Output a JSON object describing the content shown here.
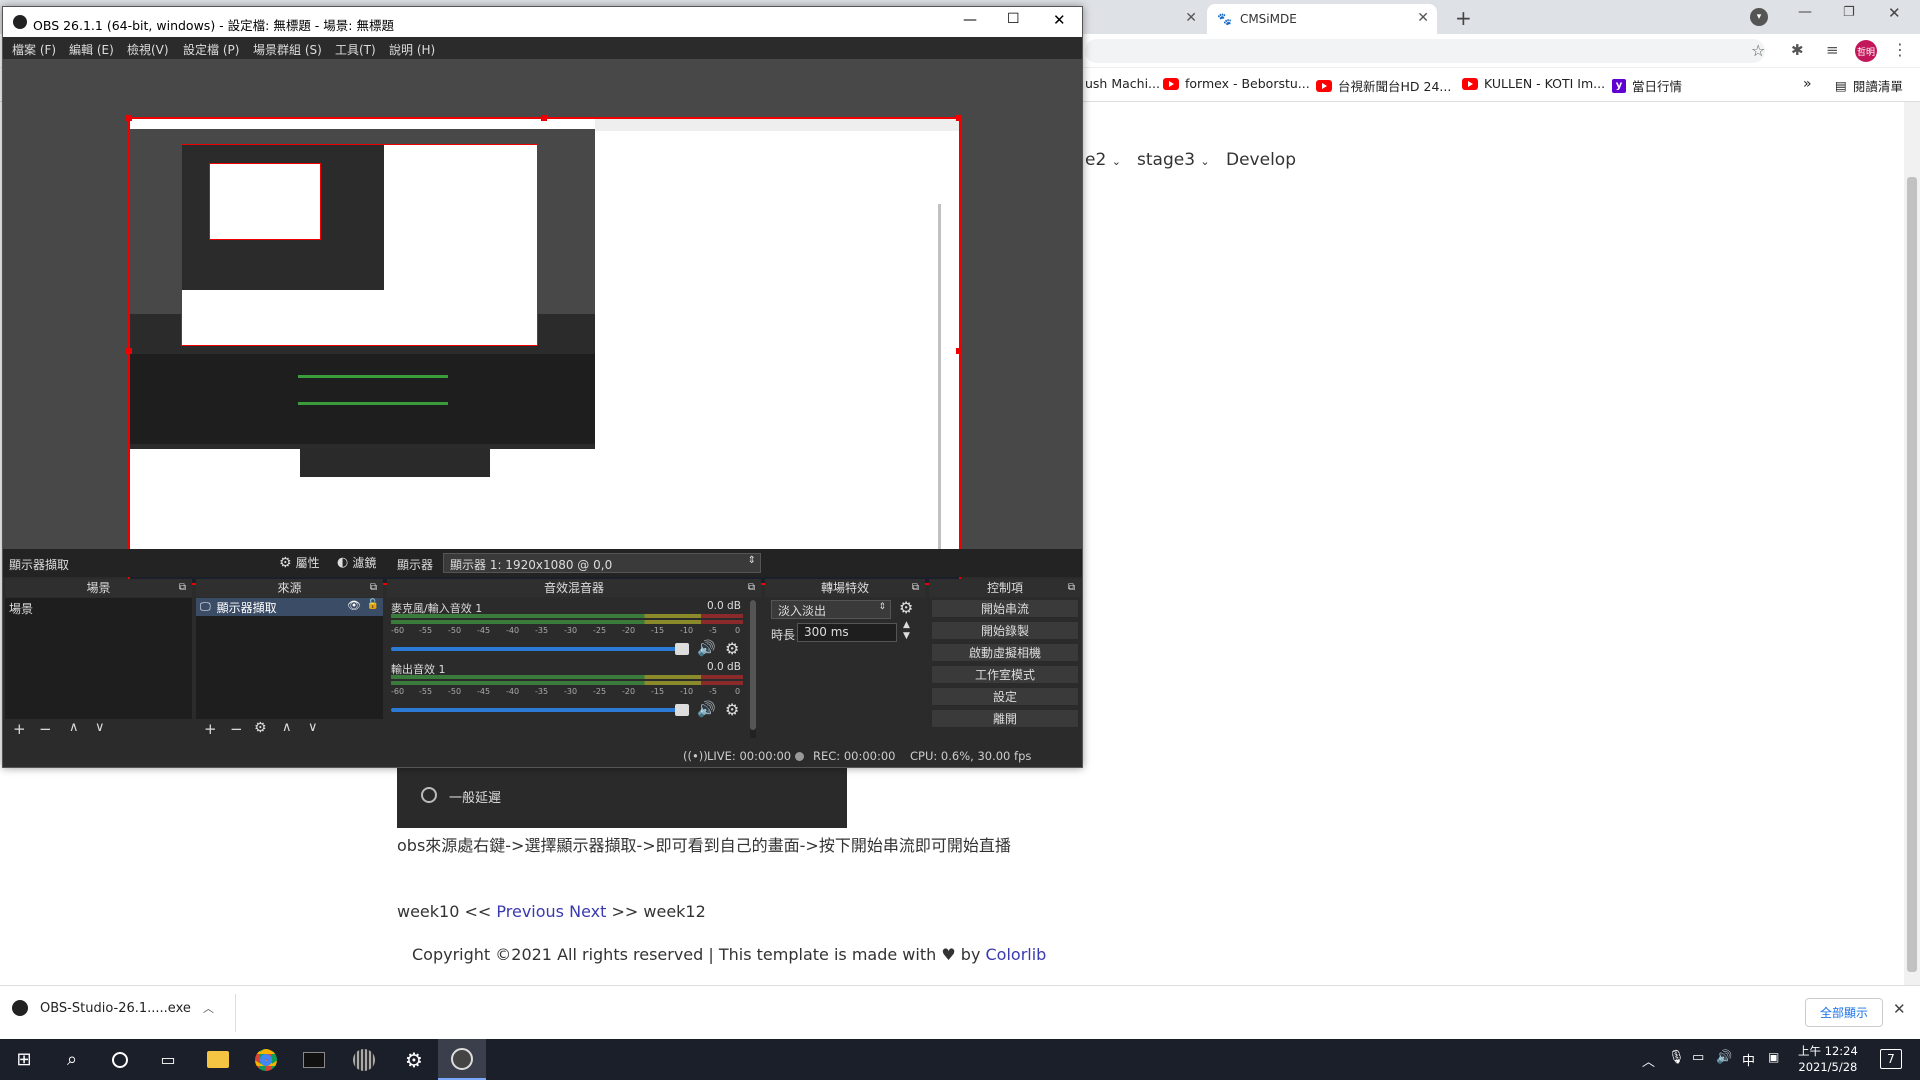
{
  "browser": {
    "tabs": [
      {
        "label": ""
      },
      {
        "label": "CMSiMDE"
      }
    ],
    "new_tab": "+",
    "bookmarks": [
      {
        "label": "ush Machi..."
      },
      {
        "label": "formex - Beborstu..."
      },
      {
        "label": "台視新聞台HD 24..."
      },
      {
        "label": "KULLEN - KOTI Im..."
      },
      {
        "label": "當日行情"
      }
    ],
    "bookmarks_more": "»",
    "reading_list": "閱讀清單",
    "profile": "哲明"
  },
  "website": {
    "nav": [
      "e2",
      "stage3",
      "Develop"
    ],
    "option_label": "一般延遲",
    "instruction": "obs來源處右鍵->選擇顯示器擷取->即可看到自己的畫面->按下開始串流即可開始直播",
    "pager": {
      "prev_page": "week10 <<",
      "previous": "Previous",
      "next": "Next",
      "next_page": ">> week12"
    },
    "copyright": "Copyright ©2021 All rights reserved | This template is made with",
    "copyright_by": "by",
    "copyright_link": "Colorlib"
  },
  "downloads": {
    "file": "OBS-Studio-26.1.....exe",
    "show_all": "全部顯示"
  },
  "taskbar": {
    "time": "上午 12:24",
    "date": "2021/5/28",
    "ime": "中",
    "notifications": "7"
  },
  "obs": {
    "title": "OBS 26.1.1 (64-bit, windows) - 設定檔: 無標題 - 場景: 無標題",
    "menu": [
      "檔案 (F)",
      "編輯 (E)",
      "檢視(V)",
      "設定檔 (P)",
      "場景群組 (S)",
      "工具(T)",
      "說明 (H)"
    ],
    "source_bar": {
      "name": "顯示器擷取",
      "properties": "屬性",
      "filters": "濾鏡",
      "display_label": "顯示器",
      "display_value": "顯示器 1: 1920x1080 @ 0,0"
    },
    "docks": {
      "scenes": {
        "title": "場景",
        "items": [
          "場景"
        ]
      },
      "sources": {
        "title": "來源",
        "items": [
          "顯示器擷取"
        ]
      },
      "mixer": {
        "title": "音效混音器",
        "channels": [
          {
            "name": "麥克風/輸入音效 1",
            "db": "0.0 dB"
          },
          {
            "name": "輸出音效 1",
            "db": "0.0 dB"
          }
        ],
        "scale": [
          "-60",
          "-55",
          "-50",
          "-45",
          "-40",
          "-35",
          "-30",
          "-25",
          "-20",
          "-15",
          "-10",
          "-5",
          "0"
        ]
      },
      "transitions": {
        "title": "轉場特效",
        "selected": "淡入淡出",
        "duration_label": "時長",
        "duration": "300 ms"
      },
      "controls": {
        "title": "控制項",
        "buttons": [
          "開始串流",
          "開始錄製",
          "啟動虛擬相機",
          "工作室模式",
          "設定",
          "離開"
        ]
      }
    },
    "status": {
      "live": "LIVE: 00:00:00",
      "rec": "REC: 00:00:00",
      "cpu": "CPU: 0.6%, 30.00 fps"
    }
  }
}
